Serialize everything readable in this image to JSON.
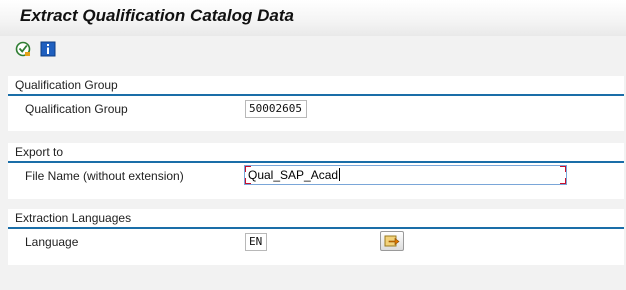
{
  "window": {
    "title": "Extract Qualification Catalog Data"
  },
  "toolbar": {
    "execute_icon": "execute-icon",
    "info_icon": "info-icon"
  },
  "qualification_group": {
    "header": "Qualification Group",
    "label": "Qualification Group",
    "value": "50002605"
  },
  "export_to": {
    "header": "Export to",
    "label": "File Name (without extension)",
    "value": "Qual_SAP_Acad"
  },
  "extraction_languages": {
    "header": "Extraction Languages",
    "label": "Language",
    "value": "EN",
    "multi_select_icon": "multiple-selection-icon"
  },
  "colors": {
    "accent": "#1a6ea8",
    "required_marker": "#c8102e"
  }
}
